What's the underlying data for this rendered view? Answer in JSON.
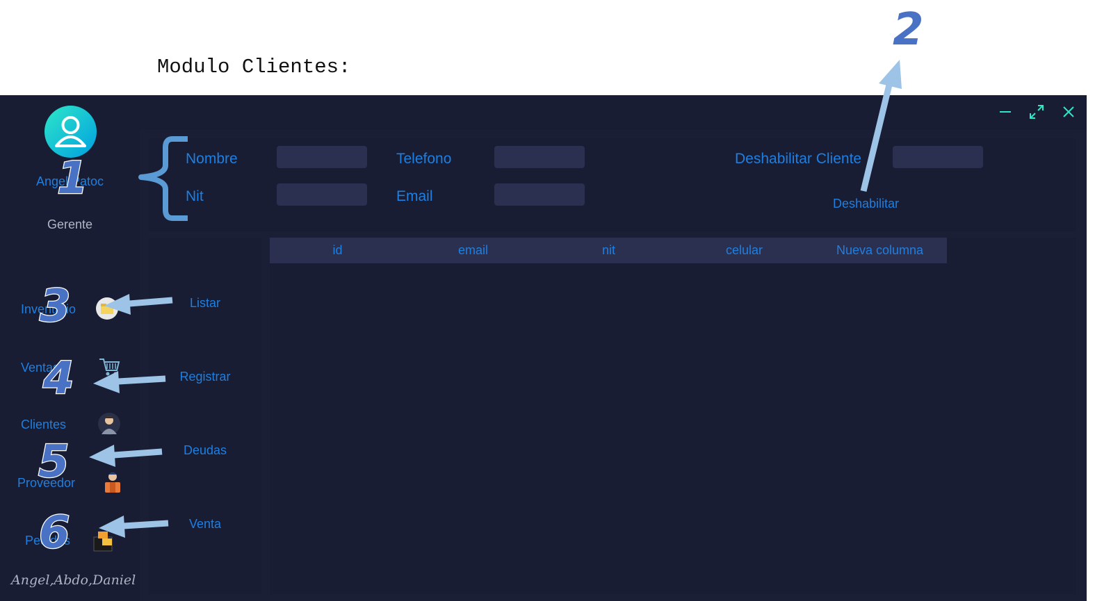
{
  "heading": "Modulo Clientes:",
  "sidebar": {
    "user_name": "Angel Patoc",
    "user_role": "Gerente",
    "nav": [
      {
        "label": "Inventario",
        "icon": "inventory-icon"
      },
      {
        "label": "Ventas",
        "icon": "shopping-cart-icon"
      },
      {
        "label": "Clientes",
        "icon": "customer-icon"
      },
      {
        "label": "Proveedor",
        "icon": "supplier-icon"
      },
      {
        "label": "Pedidos",
        "icon": "orders-icon"
      }
    ],
    "signature": "Angel,Abdo,Daniel"
  },
  "form": {
    "nombre_label": "Nombre",
    "nit_label": "Nit",
    "telefono_label": "Telefono",
    "email_label": "Email",
    "deshabilitar_label": "Deshabilitar Cliente",
    "deshabilitar_link": "Deshabilitar"
  },
  "actions": [
    "Listar",
    "Registrar",
    "Deudas",
    "Venta"
  ],
  "table": {
    "columns": [
      "id",
      "email",
      "nit",
      "celular",
      "Nueva columna"
    ]
  },
  "annotations": [
    "1",
    "2",
    "3",
    "4",
    "5",
    "6"
  ],
  "colors": {
    "accent": "#1f7fe0",
    "panel": "#181d33",
    "background": "#1a1f35",
    "input": "#2b3050",
    "arrow": "#9dc3e6",
    "annotation": "#4a72c4"
  }
}
